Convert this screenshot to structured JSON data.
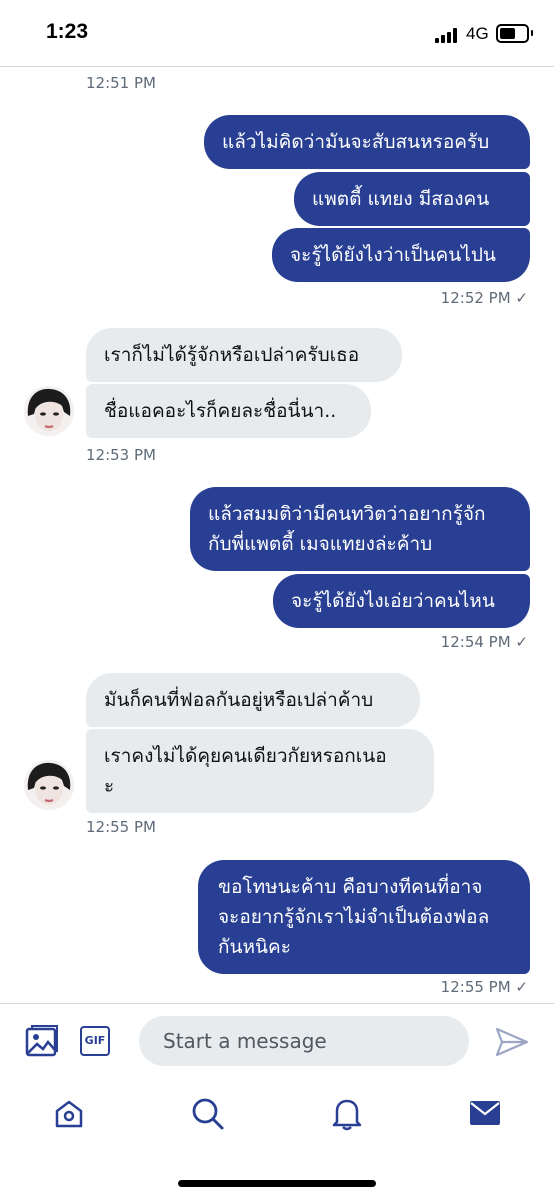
{
  "status_bar": {
    "time": "1:23",
    "network": "4G"
  },
  "messages": [
    {
      "kind": "timestamp",
      "text": "12:51 PM"
    },
    {
      "kind": "sent",
      "text": "แล้วไม่คิดว่ามันจะสับสนหรอครับ"
    },
    {
      "kind": "sent",
      "text": "แพตตี้ แทยง มีสองคน"
    },
    {
      "kind": "sent",
      "text": "จะรู้ได้ยังไงว่าเป็นคนไปน"
    },
    {
      "kind": "timestamp",
      "text": "12:52 PM ✓"
    },
    {
      "kind": "received",
      "text": "เราก็ไม่ได้รู้จักหรือเปล่าครับเธอ"
    },
    {
      "kind": "received",
      "text": "ชื่อแอคอะไรก็คยละชื่อนี่นา.."
    },
    {
      "kind": "timestamp",
      "text": "12:53 PM"
    },
    {
      "kind": "sent",
      "text": "แล้วสมมติว่ามีคนทวิตว่าอยากรู้จัก\nกับพี่แพตตี้ เมจแทยงล่ะค้าบ"
    },
    {
      "kind": "sent",
      "text": "จะรู้ได้ยังไงเอ่ยว่าคนไหน"
    },
    {
      "kind": "timestamp",
      "text": "12:54 PM ✓"
    },
    {
      "kind": "received",
      "text": "มันก็คนที่ฟอลกันอยู่หรือเปล่าค้าบ"
    },
    {
      "kind": "received",
      "text": "เราคงไม่ได้คุยคนเดียวกัยหรอกเนอ\nะ"
    },
    {
      "kind": "timestamp",
      "text": "12:55 PM"
    },
    {
      "kind": "sent",
      "text": "ขอโทษนะค้าบ คือบางทีคนที่อาจ\nจะอยากรู้จักเราไม่จำเป็นต้องฟอล\nกันหนิคะ"
    },
    {
      "kind": "timestamp",
      "text": "12:55 PM ✓"
    }
  ],
  "composer": {
    "placeholder": "Start a message",
    "gif_label": "GIF"
  },
  "tabbar": {
    "items": [
      "home-icon",
      "search-icon",
      "notifications-icon",
      "messages-icon"
    ]
  },
  "colors": {
    "accent": "#283f93",
    "received_bubble": "#e8ebee",
    "timestamp": "#5f6b78"
  }
}
